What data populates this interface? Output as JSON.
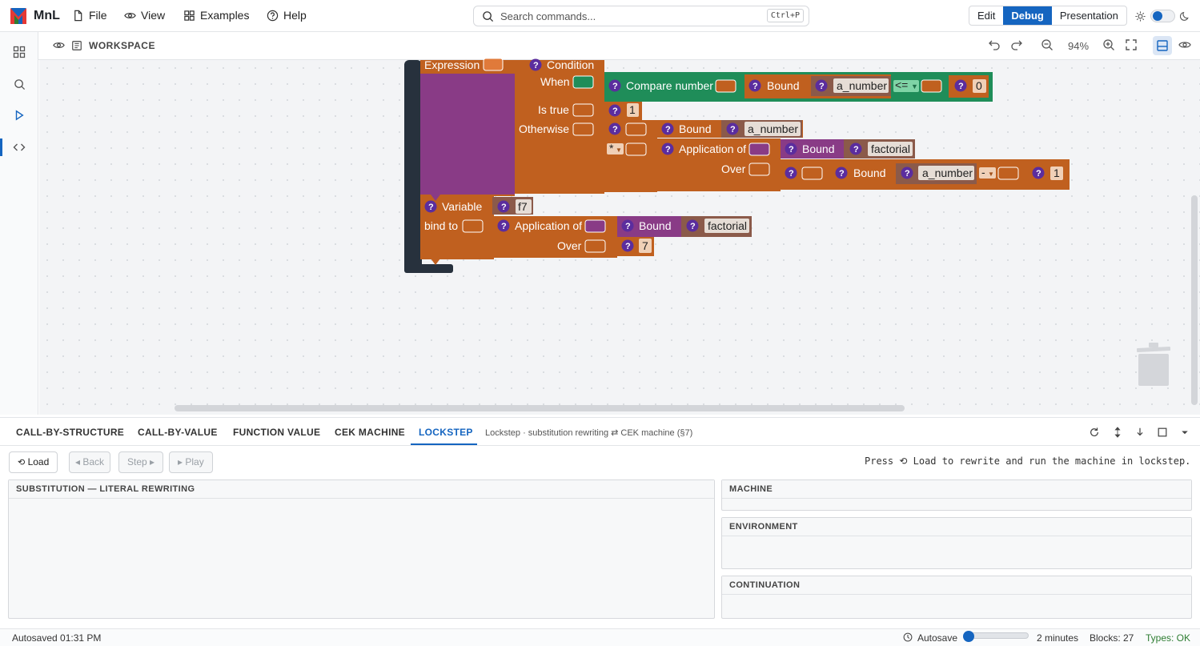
{
  "app": {
    "name": "MnL"
  },
  "menu": [
    {
      "label": "File",
      "icon": "file-icon"
    },
    {
      "label": "View",
      "icon": "eye-icon"
    },
    {
      "label": "Examples",
      "icon": "grid-icon"
    },
    {
      "label": "Help",
      "icon": "help-icon"
    }
  ],
  "search": {
    "placeholder": "Search commands...",
    "shortcut": "Ctrl+P"
  },
  "modes": {
    "edit": "Edit",
    "debug": "Debug",
    "presentation": "Presentation",
    "active": "Debug"
  },
  "workspace": {
    "title": "WORKSPACE",
    "zoom": "94%"
  },
  "blocks": {
    "expression": "Expression",
    "condition": "Condition",
    "when": "When",
    "compare": "Compare number",
    "bound": "Bound",
    "a_number": "a_number",
    "op_le": "<=",
    "zero": "0",
    "is_true": "Is true",
    "one": "1",
    "otherwise": "Otherwise",
    "times": "*",
    "application_of": "Application of",
    "factorial": "factorial",
    "over": "Over",
    "minus": "-",
    "variable": "Variable",
    "f7": "f7",
    "bind_to": "bind to",
    "seven": "7",
    "help": "?"
  },
  "colors": {
    "accent": "#1565c0",
    "orange_block": "#c0601f",
    "purple_block": "#893b86",
    "green_block": "#1f8d59",
    "brown_field": "#8b5a4a",
    "dark_frame": "#27313d"
  },
  "panel": {
    "tabs": [
      "CALL-BY-STRUCTURE",
      "CALL-BY-VALUE",
      "FUNCTION VALUE",
      "CEK MACHINE",
      "LOCKSTEP"
    ],
    "active_tab": "LOCKSTEP",
    "subtitle": "Lockstep · substitution rewriting ⇄ CEK machine (§7)",
    "buttons": {
      "load": "Load",
      "back": "◂ Back",
      "step": "Step ▸",
      "play": "▸ Play"
    },
    "hint": "Press ⟲ Load to rewrite and run the machine in lockstep.",
    "sections": {
      "substitution": "SUBSTITUTION — LITERAL REWRITING",
      "machine": "MACHINE",
      "environment": "ENVIRONMENT",
      "continuation": "CONTINUATION"
    }
  },
  "status": {
    "autosaved": "Autosaved 01:31 PM",
    "autosave_label": "Autosave",
    "autosave_interval": "2 minutes",
    "blocks": "Blocks: 27",
    "types": "Types: OK"
  }
}
